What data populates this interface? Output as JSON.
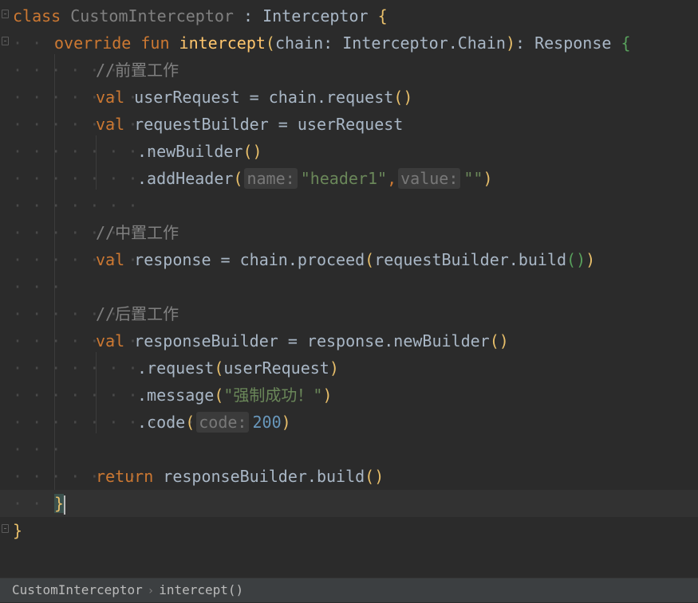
{
  "editor": {
    "lines": [
      {
        "id": "l1",
        "tokens": [
          "class",
          "CustomInterceptor",
          ":",
          "Interceptor",
          "{"
        ]
      },
      {
        "id": "l2",
        "tokens": [
          "override",
          "fun",
          "intercept",
          "(",
          "chain",
          ":",
          "Interceptor.Chain",
          ")",
          ":",
          "Response",
          "{"
        ]
      }
    ],
    "t": {
      "class_kw": "class",
      "class_name": "CustomInterceptor",
      "colon_sp": " : ",
      "interceptor": "Interceptor",
      "open_brace": "{",
      "close_brace": "}",
      "override_kw": "override",
      "fun_kw": "fun",
      "fn_name": "intercept",
      "lparen": "(",
      "rparen": ")",
      "param": "chain: Interceptor.Chain",
      "ret_sep": ": ",
      "ret_type": "Response",
      "comment_pre": "//前置工作",
      "comment_mid": "//中置工作",
      "comment_post": "//后置工作",
      "val_kw": "val",
      "user_request_decl": "userRequest = chain.request",
      "request_builder_decl": "requestBuilder = userRequest",
      "new_builder": ".newBuilder",
      "add_header": ".addHeader",
      "hint_name": "name:",
      "str_header1": "\"header1\"",
      "comma": ",",
      "hint_value": "value:",
      "str_empty": "\"\"",
      "response_decl": "response = chain.proceed",
      "request_builder_build": "requestBuilder.build",
      "response_builder_decl": "responseBuilder = response.newBuilder",
      "request_call": ".request",
      "user_request_arg": "userRequest",
      "message_call": ".message",
      "str_message": "\"强制成功！\"",
      "code_call": ".code",
      "hint_code": "code:",
      "num_200": "200",
      "return_kw": "return",
      "return_expr": "responseBuilder.build"
    }
  },
  "breadcrumbs": {
    "items": [
      "CustomInterceptor",
      "intercept()"
    ],
    "separator": "›"
  },
  "colors": {
    "background": "#2b2b2b",
    "keyword": "#cc7832",
    "function": "#ffc66d",
    "string": "#6a8759",
    "number": "#6897bb",
    "comment": "#808080",
    "text": "#a9b7c6"
  }
}
